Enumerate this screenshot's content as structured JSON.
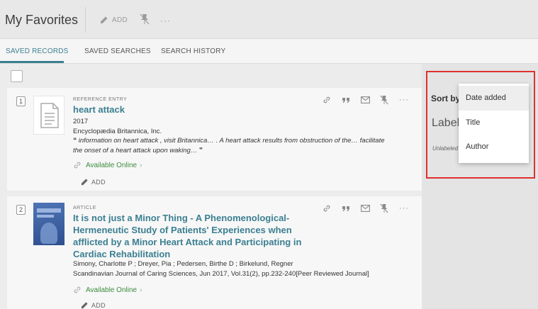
{
  "header": {
    "title": "My Favorites",
    "add_label": "ADD",
    "more_label": "···"
  },
  "tabs": [
    {
      "label": "SAVED RECORDS",
      "active": true
    },
    {
      "label": "SAVED SEARCHES",
      "active": false
    },
    {
      "label": "SEARCH HISTORY",
      "active": false
    }
  ],
  "records": [
    {
      "number": "1",
      "type": "REFERENCE ENTRY",
      "title": "heart attack",
      "year": "2017",
      "publisher": "Encyclopædia Britannica, Inc.",
      "snippet_quote_open": "❝",
      "snippet": "information on heart attack , visit Britannica… . A heart attack results from obstruction of the… facilitate the onset of a heart attack upon waking…",
      "snippet_quote_close": "❞",
      "availability": "Available Online",
      "add_label": "ADD",
      "more_label": "···"
    },
    {
      "number": "2",
      "type": "ARTICLE",
      "title": "It is not just a Minor Thing - A Phenomenological-Hermeneutic Study of Patients' Experiences when afflicted by a Minor Heart Attack and Participating in Cardiac Rehabilitation",
      "authors": "Simony, Charlotte P ; Dreyer, Pia ; Pedersen, Birthe D ; Birkelund, Regner",
      "source": "Scandinavian Journal of Caring Sciences, Jun 2017, Vol.31(2), pp.232-240[Peer Reviewed Journal]",
      "availability": "Available Online",
      "add_label": "ADD",
      "more_label": "···"
    }
  ],
  "sidebar": {
    "sort_label": "Sort by",
    "labels_title": "Labels",
    "unlabeled": "Unlabeled"
  },
  "sort_dropdown": {
    "options": [
      "Date added",
      "Title",
      "Author"
    ],
    "selected": "Date added"
  },
  "colors": {
    "accent": "#3b7f91",
    "available": "#3c8c3c",
    "highlight": "#e03030"
  }
}
